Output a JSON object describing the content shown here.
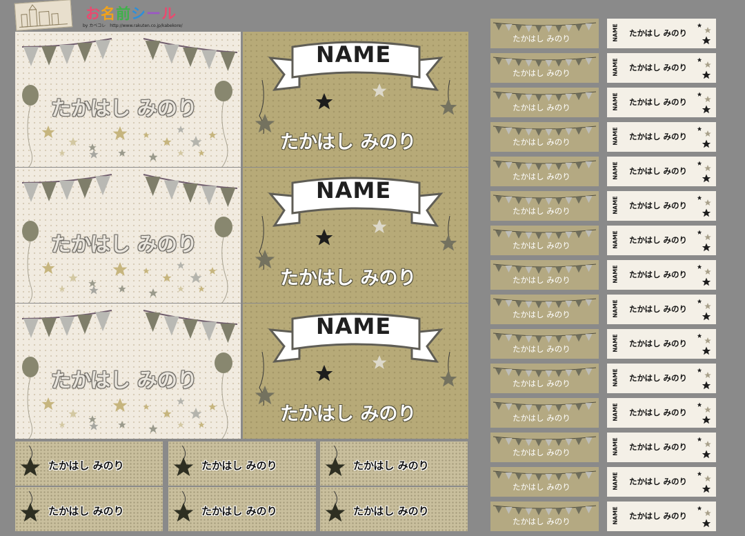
{
  "header": {
    "brand_title_chars": [
      "お",
      "名",
      "前",
      "シ",
      "ー",
      "ル"
    ],
    "brand_subtitle": "by カベコレ　http://www.rakuten.co.jp/kabekore/"
  },
  "labels": {
    "name": "たかはし みのり",
    "name_wide": "たかはし  みのり",
    "ribbon_text": "NAME",
    "vertical_name": "NAME"
  },
  "colors": {
    "background": "#8a8a8a",
    "cream": "#f1ebe0",
    "khaki": "#b7aa78",
    "dark_olive": "#74725f",
    "star_black": "#1d1d1d"
  },
  "icons": {
    "banner": "bunting-flags-icon",
    "balloon": "balloon-icon",
    "star": "star-icon",
    "ribbon": "ribbon-banner-icon"
  }
}
